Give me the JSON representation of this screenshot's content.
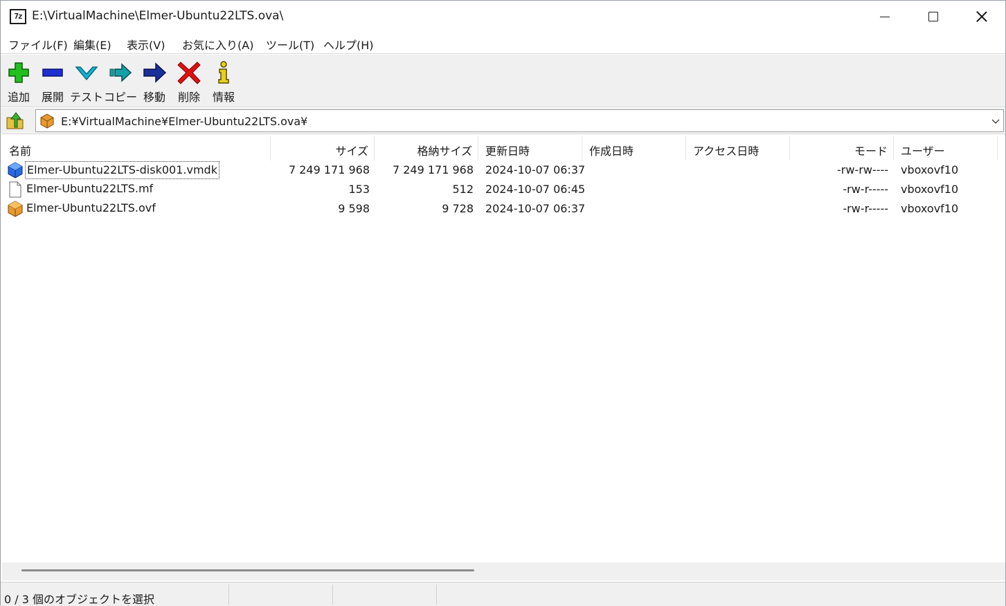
{
  "window": {
    "title": "E:\\VirtualMachine\\Elmer-Ubuntu22LTS.ova\\",
    "app_icon_label": "7z"
  },
  "menu": {
    "items": [
      "ファイル(F)",
      "編集(E)",
      "表示(V)",
      "お気に入り(A)",
      "ツール(T)",
      "ヘルプ(H)"
    ]
  },
  "toolbar": {
    "add": "追加",
    "extract": "展開",
    "test": "テスト",
    "copy": "コピー",
    "move": "移動",
    "delete": "削除",
    "info": "情報"
  },
  "address": {
    "path": "E:¥VirtualMachine¥Elmer-Ubuntu22LTS.ova¥"
  },
  "columns": {
    "name": "名前",
    "size": "サイズ",
    "packed": "格納サイズ",
    "modified": "更新日時",
    "created": "作成日時",
    "accessed": "アクセス日時",
    "mode": "モード",
    "user": "ユーザー"
  },
  "files": [
    {
      "name": "Elmer-Ubuntu22LTS-disk001.vmdk",
      "size": "7 249 171 968",
      "packed": "7 249 171 968",
      "modified": "2024-10-07 06:37",
      "created": "",
      "accessed": "",
      "mode": "-rw-rw----",
      "user": "vboxovf10",
      "icon": "vmdk-disk-icon"
    },
    {
      "name": "Elmer-Ubuntu22LTS.mf",
      "size": "153",
      "packed": "512",
      "modified": "2024-10-07 06:45",
      "created": "",
      "accessed": "",
      "mode": "-rw-r-----",
      "user": "vboxovf10",
      "icon": "blank-file-icon"
    },
    {
      "name": "Elmer-Ubuntu22LTS.ovf",
      "size": "9 598",
      "packed": "9 728",
      "modified": "2024-10-07 06:37",
      "created": "",
      "accessed": "",
      "mode": "-rw-r-----",
      "user": "vboxovf10",
      "icon": "ovf-package-icon"
    }
  ],
  "status": {
    "selection": "0 / 3 個のオブジェクトを選択"
  },
  "colors": {
    "add_green": "#22c01e",
    "extract_blue": "#1f2fd0",
    "test_cyan": "#12b3d3",
    "copy_teal": "#14a0a8",
    "move_navy": "#1a2f9a",
    "delete_red": "#e01010",
    "info_yellow": "#e8d020"
  }
}
